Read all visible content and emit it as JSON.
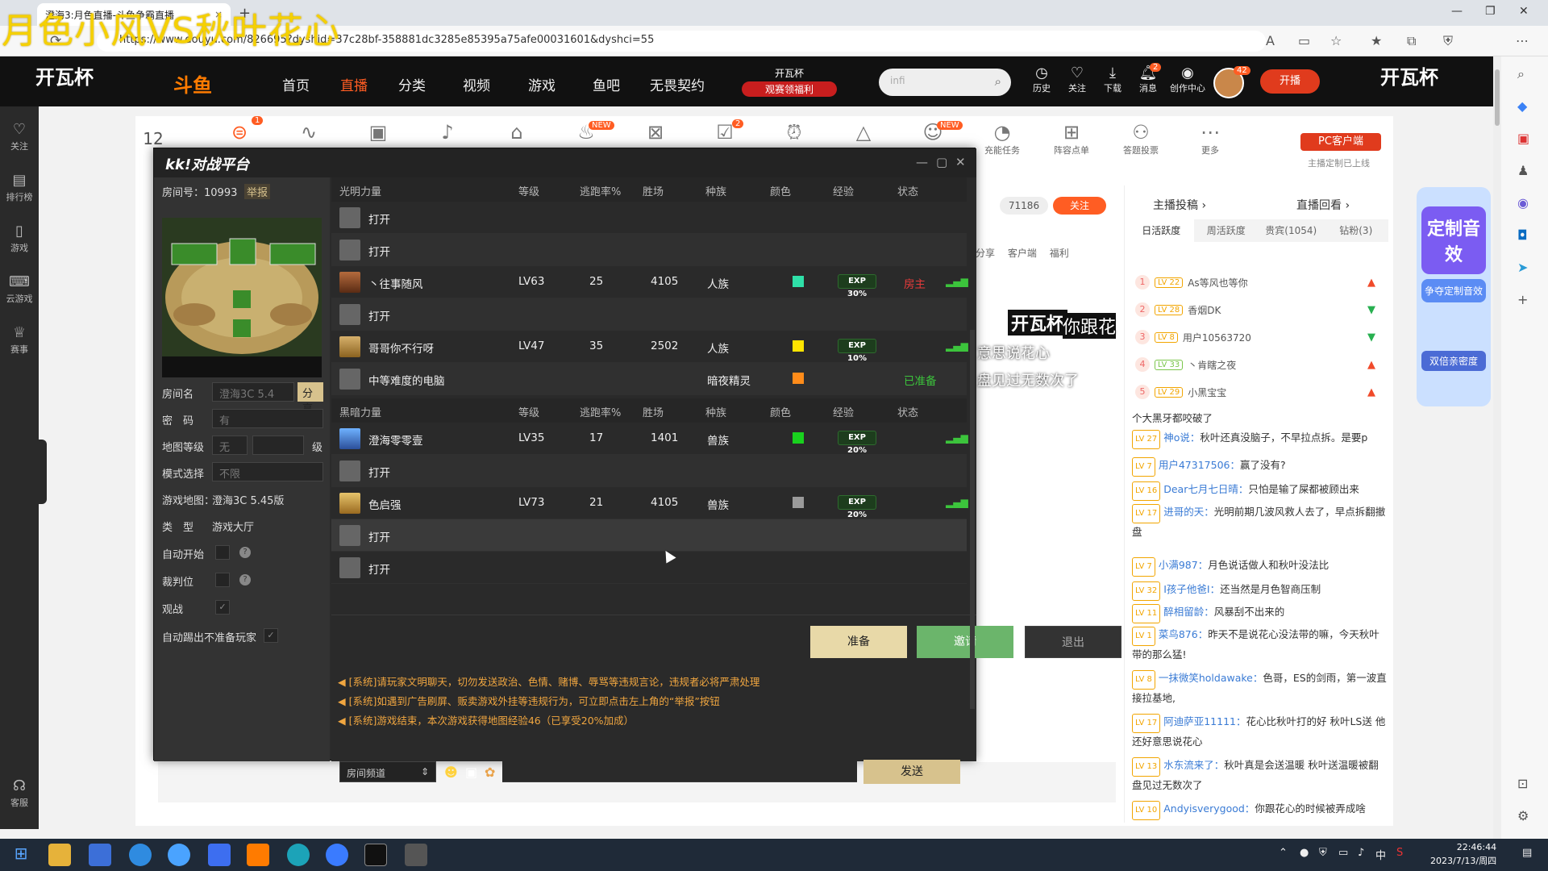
{
  "overlay_text": "月色小风VS秋叶花心",
  "browser": {
    "tab_title": "澄海3:月色直播-斗鱼争霸直播",
    "tab_close": "×",
    "new_tab": "+",
    "url": "https://www.douyu.com/826695?dyshid=37c28bf-358881dc3285e85395a75afe00031601&dyshci=55"
  },
  "douyu_nav": {
    "brand_left": "开瓦杯",
    "logo": "斗鱼",
    "items": [
      "首页",
      "直播",
      "分类",
      "视频",
      "游戏",
      "鱼吧",
      "无畏契约"
    ],
    "active": "直播",
    "badge_line1": "开瓦杯",
    "badge_line2": "观赛领福利",
    "search_placeholder": "infi",
    "icons": [
      {
        "label": "历史",
        "icon": "clock-icon"
      },
      {
        "label": "关注",
        "icon": "heart-icon"
      },
      {
        "label": "下载",
        "icon": "download-icon"
      },
      {
        "label": "消息",
        "icon": "bell-icon",
        "badge": "2"
      },
      {
        "label": "创作中心",
        "icon": "bulb-icon"
      }
    ],
    "avatar_badge": "42",
    "kaibo": "开播",
    "brand_right": "开瓦杯"
  },
  "dy_left": [
    {
      "label": "关注",
      "icon": "heart-icon"
    },
    {
      "label": "排行榜",
      "icon": "rank-icon"
    },
    {
      "label": "游戏",
      "icon": "gamepad-icon"
    },
    {
      "label": "云游戏",
      "icon": "cloud-game-icon"
    },
    {
      "label": "赛事",
      "icon": "trophy-icon"
    },
    {
      "label": "客服",
      "icon": "headset-icon"
    }
  ],
  "toolbar": {
    "number": "12",
    "items": [
      {
        "label": "",
        "icon": "toggle-icon",
        "badge": "1"
      },
      {
        "label": "",
        "icon": "pulse-icon"
      },
      {
        "label": "",
        "icon": "ad-icon"
      },
      {
        "label": "",
        "icon": "tiktok-icon"
      },
      {
        "label": "",
        "icon": "gift-icon"
      },
      {
        "label": "",
        "icon": "fire-icon",
        "badge": "NEW"
      },
      {
        "label": "",
        "icon": "pk-icon"
      },
      {
        "label": "",
        "icon": "task-icon",
        "badge": "2"
      },
      {
        "label": "",
        "icon": "alarm-icon"
      },
      {
        "label": "",
        "icon": "pyramid-icon"
      },
      {
        "label": "",
        "icon": "group-icon",
        "badge": "NEW"
      },
      {
        "label": "充能任务",
        "icon": "gauge-icon"
      },
      {
        "label": "阵容点单",
        "icon": "lineup-icon"
      },
      {
        "label": "答题投票",
        "icon": "vote-icon"
      },
      {
        "label": "更多",
        "icon": "more-icon"
      }
    ],
    "pc_client": "PC客户端",
    "pc_client_sub": "主播定制已上线"
  },
  "room": {
    "follow_count": "71186",
    "follow_btn": "关注",
    "share_items": [
      "分享",
      "客户端",
      "福利"
    ]
  },
  "right_panel": {
    "head_left": "主播投稿",
    "head_right": "直播回看",
    "tabs": [
      "日活跃度",
      "周活跃度",
      "贵宾(1054)",
      "钻粉(3)"
    ],
    "ranks": [
      {
        "n": "1",
        "lv": "LV 22",
        "name": "As等风也等你",
        "dir": "up"
      },
      {
        "n": "2",
        "lv": "LV 28",
        "name": "香烟DK",
        "dir": "down"
      },
      {
        "n": "3",
        "lv": "LV 8",
        "name": "用户10563720",
        "dir": "down"
      },
      {
        "n": "4",
        "lv": "LV 33",
        "name": "丶肯瞎之夜",
        "dir": "up"
      },
      {
        "n": "5",
        "lv": "LV 29",
        "name": "小黑宝宝",
        "dir": "up"
      }
    ],
    "chat": [
      {
        "lv": "",
        "name": "",
        "text": "个大黑牙都咬破了"
      },
      {
        "lv": "LV 27",
        "name": "神o说：",
        "text": "秋叶还真没脑子，不早拉点拆。是要p"
      },
      {
        "lv": "LV 7",
        "name": "用户47317506：",
        "text": "赢了没有?"
      },
      {
        "lv": "LV 16",
        "name": "Dear七月七日晴：",
        "text": "只怕是输了屎都被顾出来"
      },
      {
        "lv": "LV 17",
        "name": "进哥的天：",
        "text": "光明前期几波风救人去了，早点拆翻撤盘"
      },
      {
        "lv": "LV 7",
        "name": "小满987：",
        "text": "月色说话做人和秋叶没法比"
      },
      {
        "lv": "LV 32",
        "name": "I孩子他爸I：",
        "text": "还当然是月色智商压制"
      },
      {
        "lv": "LV 11",
        "name": "醉相留龄：",
        "text": "风暴刮不出来的"
      },
      {
        "lv": "LV 1",
        "name": "菜鸟876：",
        "text": "昨天不是说花心没法带的嘛，今天秋叶带的那么猛!"
      },
      {
        "lv": "LV 8",
        "name": "一抹微笑holdawake：",
        "text": "色哥，ES的剑雨，第一波直接拉基地,"
      },
      {
        "lv": "LV 17",
        "name": "阿迪萨亚11111：",
        "text": "花心比秋叶打的好 秋叶LS送 他还好意思说花心"
      },
      {
        "lv": "LV 13",
        "name": "水东流来了：",
        "text": "秋叶真是会送温暖 秋叶送温暖被翻盘见过无数次了"
      },
      {
        "lv": "LV 10",
        "name": "Andyisverygood：",
        "text": "你跟花心的时候被弄成啥"
      }
    ]
  },
  "promo": {
    "big": "定制音效",
    "mid": "争夺定制音效",
    "bottom": "双倍亲密度"
  },
  "stream_overlay": {
    "title": "开瓦杯",
    "tag": "你跟花",
    "line1": "意思说花心",
    "line2": "盘见过无数次了"
  },
  "kk": {
    "logo": "kk!对战平台",
    "room_no_label": "房间号：",
    "room_no": "10993",
    "report": "举报",
    "room_name_label": "房间名",
    "room_name_value": "澄海3C 5.4",
    "share": "分享",
    "password_label": "密　码",
    "password_value": "有",
    "map_level_label": "地图等级",
    "map_level_value": "无",
    "map_level_unit": "级",
    "mode_label": "模式选择",
    "mode_value": "不限",
    "game_map_label": "游戏地图：",
    "game_map_value": "澄海3C 5.45版",
    "type_label": "类　型",
    "type_value": "游戏大厅",
    "auto_start_label": "自动开始",
    "referee_label": "裁判位",
    "spectate_label": "观战",
    "auto_kick_label": "自动踢出不准备玩家",
    "columns": [
      "等级",
      "逃跑率%",
      "胜场",
      "种族",
      "颜色",
      "经验",
      "状态"
    ],
    "light_title": "光明力量",
    "dark_title": "黑暗力量",
    "light_rows": [
      {
        "name": "打开",
        "type": "open"
      },
      {
        "name": "打开",
        "type": "open"
      },
      {
        "name": "丶往事随风",
        "lv": "LV63",
        "escape": "25",
        "wins": "4105",
        "race": "人族",
        "color": "#2fe0a8",
        "exp": "EXP 30%",
        "status": "房主",
        "status_color": "red",
        "avatar": "av1"
      },
      {
        "name": "打开",
        "type": "open"
      },
      {
        "name": "哥哥你不行呀",
        "lv": "LV47",
        "escape": "35",
        "wins": "2502",
        "race": "人族",
        "color": "#ffe400",
        "exp": "EXP 10%",
        "status": "",
        "avatar": "av2"
      },
      {
        "name": "中等难度的电脑",
        "lv": "",
        "escape": "",
        "wins": "",
        "race": "暗夜精灵",
        "color": "#ff8c1a",
        "exp": "",
        "status": "已准备",
        "status_color": "green",
        "avatar": "u"
      }
    ],
    "dark_rows": [
      {
        "name": "澄海零零壹",
        "lv": "LV35",
        "escape": "17",
        "wins": "1401",
        "race": "兽族",
        "color": "#19d11e",
        "exp": "EXP 20%",
        "status": "",
        "avatar": "av3"
      },
      {
        "name": "打开",
        "type": "open"
      },
      {
        "name": "色启强",
        "lv": "LV73",
        "escape": "21",
        "wins": "4105",
        "race": "兽族",
        "color": "#9a9a9a",
        "exp": "EXP 20%",
        "status": "",
        "avatar": "av4"
      },
      {
        "name": "打开",
        "type": "open"
      },
      {
        "name": "打开",
        "type": "open"
      }
    ],
    "ready_btn": "准备",
    "invite_btn": "邀请",
    "exit_btn": "退出",
    "sys_msgs": [
      "[系统]请玩家文明聊天，切勿发送政治、色情、赌博、辱骂等违规言论，违规者必将严肃处理",
      "[系统]如遇到广告刷屏、贩卖游戏外挂等违规行为，可立即点击左上角的“举报”按钮",
      "[系统]游戏结束，本次游戏获得地图经验46（已享受20%加成）"
    ],
    "channel": "房间频道",
    "send": "发送"
  },
  "taskbar": {
    "time": "22:46:44",
    "date": "2023/7/13/周四",
    "ime": "中"
  }
}
